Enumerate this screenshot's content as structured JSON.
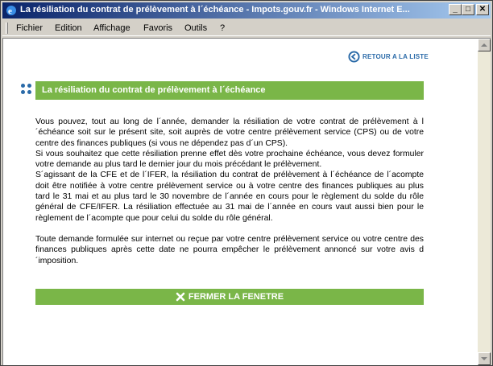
{
  "window": {
    "title": "La résiliation du contrat de prélèvement à l´échéance - Impots.gouv.fr - Windows Internet E...",
    "min_label": "_",
    "max_label": "□",
    "close_label": "✕"
  },
  "menu": {
    "items": [
      {
        "label": "Fichier"
      },
      {
        "label": "Edition"
      },
      {
        "label": "Affichage"
      },
      {
        "label": "Favoris"
      },
      {
        "label": "Outils"
      },
      {
        "label": "?"
      }
    ]
  },
  "page": {
    "back_link": "RETOUR A LA LISTE",
    "heading": "La résiliation du contrat de prélèvement à l´échéance",
    "paragraphs": [
      "Vous pouvez, tout au long de l´année, demander la résiliation de votre contrat de prélèvement à l´échéance soit sur le présent site, soit auprès de votre centre prélèvement service (CPS) ou de votre centre des finances publiques (si vous ne dépendez pas d´un CPS).",
      "Si vous souhaitez que cette résiliation prenne effet dès votre prochaine échéance, vous devez formuler votre demande au plus tard le dernier jour du mois précédant le prélèvement.",
      "S´agissant de la CFE et de l´IFER, la résiliation du contrat de prélèvement à l´échéance de l´acompte doit être notifiée à votre centre prélèvement service ou à votre centre des finances publiques au plus tard le 31 mai et au plus tard le 30 novembre de l´année en cours pour le règlement du solde du rôle général de CFE/IFER. La résiliation effectuée au 31 mai de l´année en cours vaut aussi bien pour le règlement de l´acompte que pour celui du solde du rôle général.",
      "Toute demande formulée sur internet ou reçue par votre centre prélèvement service ou votre centre des finances publiques après cette date ne pourra empêcher le prélèvement annoncé sur votre avis d´imposition."
    ],
    "close_button": "FERMER LA FENETRE"
  },
  "colors": {
    "accent_green": "#7ab648",
    "link_blue": "#2a6aa8",
    "title_gradient_start": "#0a246a"
  }
}
